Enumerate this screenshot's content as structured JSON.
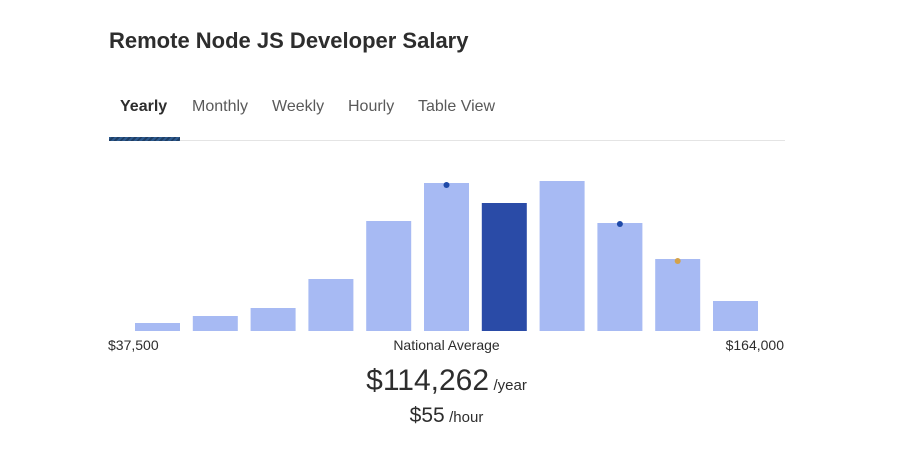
{
  "title": "Remote Node JS Developer Salary",
  "tabs": [
    {
      "label": "Yearly",
      "active": true
    },
    {
      "label": "Monthly",
      "active": false
    },
    {
      "label": "Weekly",
      "active": false
    },
    {
      "label": "Hourly",
      "active": false
    },
    {
      "label": "Table View",
      "active": false
    }
  ],
  "colors": {
    "bar": "#a7baf3",
    "bar_highlight": "#2a4ba7",
    "marker_blue": "#1f4aa8",
    "marker_gold": "#d4a24a"
  },
  "chart_data": {
    "type": "bar",
    "x_min_label": "$37,500",
    "x_max_label": "$164,000",
    "center_label": "National Average",
    "values": [
      8,
      15,
      23,
      52,
      110,
      148,
      128,
      150,
      108,
      72,
      30
    ],
    "highlight_index": 6,
    "markers": [
      {
        "bar": 5,
        "value": 146,
        "color": "blue"
      },
      {
        "bar": 8,
        "value": 107,
        "color": "blue"
      },
      {
        "bar": 9,
        "value": 70,
        "color": "gold"
      }
    ],
    "ylim": [
      0,
      160
    ]
  },
  "summary": {
    "yearly_value": "$114,262",
    "yearly_unit": "/year",
    "hourly_value": "$55",
    "hourly_unit": "/hour"
  }
}
